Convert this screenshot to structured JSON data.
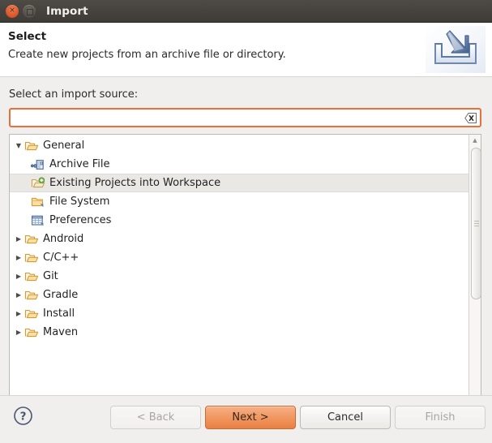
{
  "window": {
    "title": "Import",
    "close_glyph": "×",
    "buttons": {
      "close": "close-button",
      "maximize": "maximize-button"
    }
  },
  "header": {
    "title": "Select",
    "description": "Create new projects from an archive file or directory.",
    "icon": "import-wizard-icon"
  },
  "source": {
    "label": "Select an import source:",
    "filter_value": "",
    "filter_placeholder": "",
    "clear_icon": "clear-icon"
  },
  "tree": {
    "items": [
      {
        "label": "General",
        "level": 0,
        "expanded": true,
        "icon": "open-folder-icon",
        "selected": false
      },
      {
        "label": "Archive File",
        "level": 1,
        "expanded": null,
        "icon": "archive-file-icon",
        "selected": false
      },
      {
        "label": "Existing Projects into Workspace",
        "level": 1,
        "expanded": null,
        "icon": "existing-projects-icon",
        "selected": true
      },
      {
        "label": "File System",
        "level": 1,
        "expanded": null,
        "icon": "file-system-folder-icon",
        "selected": false
      },
      {
        "label": "Preferences",
        "level": 1,
        "expanded": null,
        "icon": "preferences-icon",
        "selected": false
      },
      {
        "label": "Android",
        "level": 0,
        "expanded": false,
        "icon": "open-folder-icon",
        "selected": false
      },
      {
        "label": "C/C++",
        "level": 0,
        "expanded": false,
        "icon": "open-folder-icon",
        "selected": false
      },
      {
        "label": "Git",
        "level": 0,
        "expanded": false,
        "icon": "open-folder-icon",
        "selected": false
      },
      {
        "label": "Gradle",
        "level": 0,
        "expanded": false,
        "icon": "open-folder-icon",
        "selected": false
      },
      {
        "label": "Install",
        "level": 0,
        "expanded": false,
        "icon": "open-folder-icon",
        "selected": false
      },
      {
        "label": "Maven",
        "level": 0,
        "expanded": false,
        "icon": "open-folder-icon",
        "selected": false
      }
    ],
    "expanded_arrow": "▼",
    "collapsed_arrow": "▶",
    "scrollbar": {
      "up_arrow": "▲",
      "down_arrow": "▼"
    }
  },
  "footer": {
    "help_icon": "help-icon",
    "help_glyph": "?",
    "buttons": [
      {
        "label": "< Back",
        "state": "disabled",
        "name": "back-button"
      },
      {
        "label": "Next >",
        "state": "primary",
        "name": "next-button"
      },
      {
        "label": "Cancel",
        "state": "normal",
        "name": "cancel-button"
      },
      {
        "label": "Finish",
        "state": "disabled",
        "name": "finish-button"
      }
    ]
  },
  "colors": {
    "titlebar": "#46423d",
    "close_button": "#e0562a",
    "accent_focus": "#e8703a",
    "primary_button": "#f09a64",
    "selection": "#e9e8e5",
    "body_background": "#f0efee",
    "folder_icon": "#f0b14e"
  }
}
